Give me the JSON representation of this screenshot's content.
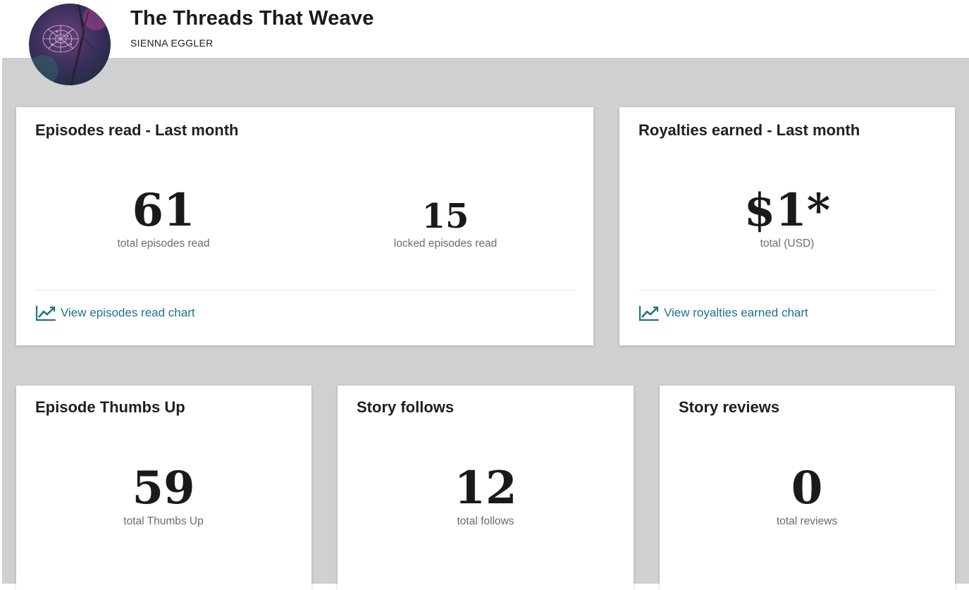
{
  "story": {
    "title": "The Threads That Weave",
    "author": "SIENNA EGGLER"
  },
  "colors": {
    "background_gray": "#d0d0d0",
    "link_teal": "#1d7388",
    "label_gray": "#6b6b6b"
  },
  "cards": {
    "episodes": {
      "title": "Episodes read - Last month",
      "metrics": [
        {
          "value": "61",
          "label": "total episodes read"
        },
        {
          "value": "15",
          "label": "locked episodes read"
        }
      ],
      "link": "View episodes read chart",
      "link_icon": "line-chart-icon"
    },
    "royalties": {
      "title": "Royalties earned - Last month",
      "metric": {
        "value": "$1*",
        "label": "total (USD)"
      },
      "link": "View royalties earned chart",
      "link_icon": "line-chart-icon"
    },
    "thumbs": {
      "title": "Episode Thumbs Up",
      "metric": {
        "value": "59",
        "label": "total Thumbs Up"
      }
    },
    "follows": {
      "title": "Story follows",
      "metric": {
        "value": "12",
        "label": "total follows"
      }
    },
    "reviews": {
      "title": "Story reviews",
      "metric": {
        "value": "0",
        "label": "total reviews"
      }
    }
  }
}
